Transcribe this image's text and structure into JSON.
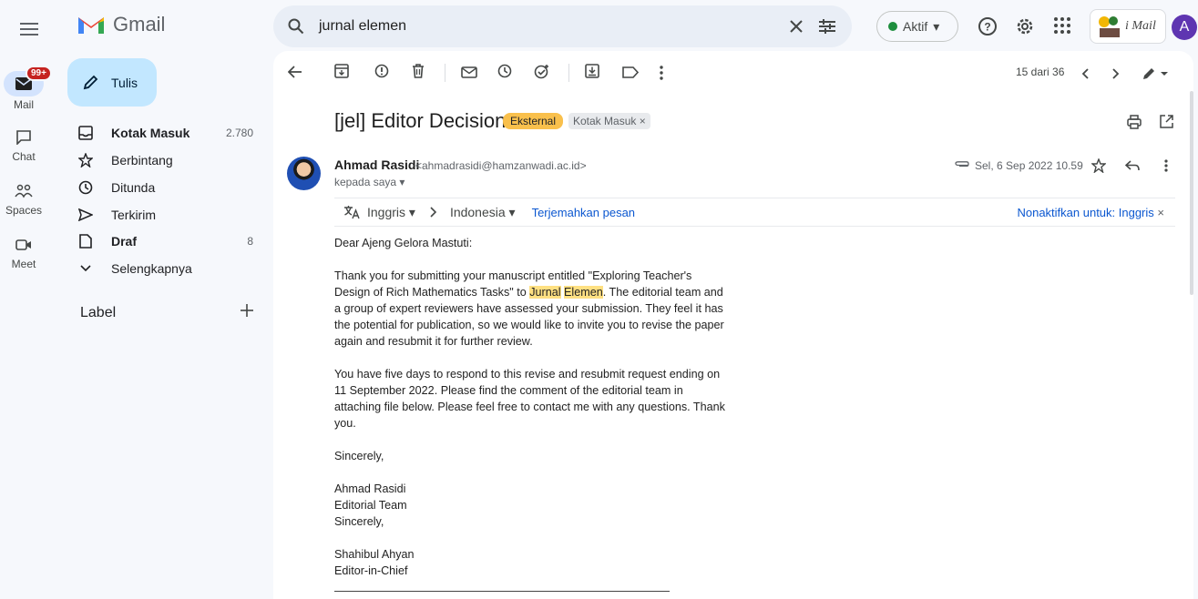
{
  "app": {
    "name": "Gmail"
  },
  "search": {
    "query": "jurnal elemen"
  },
  "status": {
    "label": "Aktif"
  },
  "rail": {
    "mail": "Mail",
    "mail_badge": "99+",
    "chat": "Chat",
    "spaces": "Spaces",
    "meet": "Meet"
  },
  "nav": {
    "compose": "Tulis",
    "items": [
      {
        "label": "Kotak Masuk",
        "count": "2.780"
      },
      {
        "label": "Berbintang",
        "count": ""
      },
      {
        "label": "Ditunda",
        "count": ""
      },
      {
        "label": "Terkirim",
        "count": ""
      },
      {
        "label": "Draf",
        "count": "8"
      },
      {
        "label": "Selengkapnya",
        "count": ""
      }
    ],
    "label_heading": "Label"
  },
  "avatar": {
    "initial": "A"
  },
  "org_logo": {
    "text": "i Mail"
  },
  "toolbar": {
    "pager": "15 dari 36"
  },
  "email": {
    "subject": "[jel] Editor Decision",
    "chips": {
      "external": "Eksternal",
      "inbox": "Kotak Masuk ×"
    },
    "sender_name": "Ahmad Rasidi",
    "sender_email": "<ahmadrasidi@hamzanwadi.ac.id>",
    "recipient": "kepada saya ▾",
    "date": "Sel, 6 Sep 2022 10.59",
    "translate": {
      "from": "Inggris ▾",
      "to": "Indonesia ▾",
      "action": "Terjemahkan pesan",
      "disable": "Nonaktifkan untuk: Inggris"
    },
    "greeting": "Dear Ajeng Gelora Mastuti:",
    "p1_pre": "Thank you for submitting your manuscript entitled \"Exploring Teacher's Design of Rich Mathematics Tasks\" to ",
    "p1_hl1": "Jurnal",
    "p1_hl2": "Elemen",
    "p1_post": ". The editorial team and a group of expert reviewers have assessed your submission. They feel it has the potential for publication, so we would like to invite you to revise the paper again and resubmit it for further review.",
    "p2": "You have five days to respond to this revise and resubmit request ending on 11 September 2022. Please find the comment of the editorial team in attaching file below. Please feel free to contact me with any questions. Thank you.",
    "closing1": "Sincerely,",
    "sig1_name": "Ahmad Rasidi",
    "sig1_role": "Editorial Team",
    "closing2": "Sincerely,",
    "sig2_name": "Shahibul Ahyan",
    "sig2_role": "Editor-in-Chief"
  }
}
